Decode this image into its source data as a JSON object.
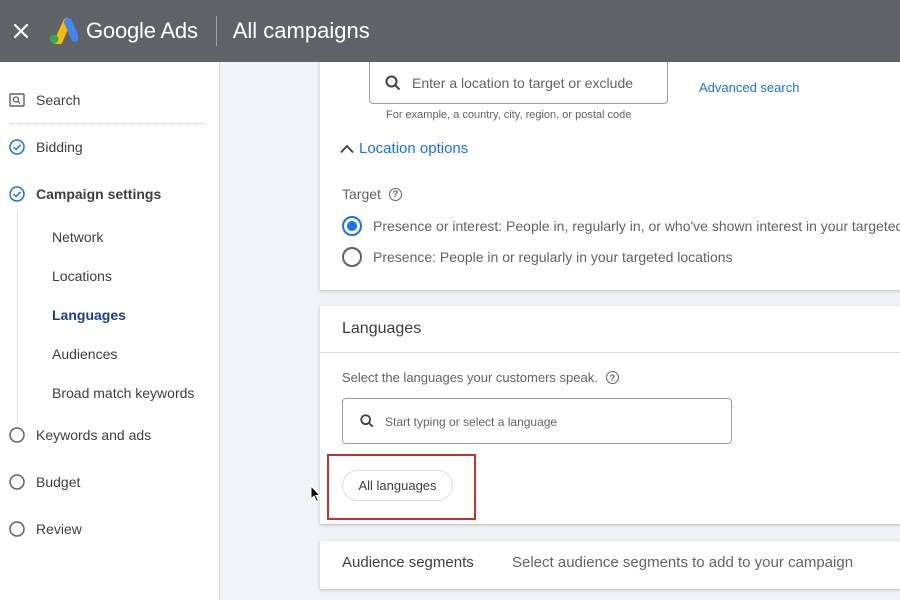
{
  "header": {
    "close_icon": "close-icon",
    "brand": "Google Ads",
    "title": "All campaigns"
  },
  "sidebar": {
    "items": [
      {
        "label": "Search",
        "icon": "search-icon",
        "state": "info"
      },
      {
        "label": "Bidding",
        "icon": "check-circle-icon",
        "state": "complete"
      },
      {
        "label": "Campaign settings",
        "icon": "check-circle-icon",
        "state": "complete"
      },
      {
        "label": "Keywords and ads",
        "icon": "circle-icon",
        "state": "incomplete"
      },
      {
        "label": "Budget",
        "icon": "circle-icon",
        "state": "incomplete"
      },
      {
        "label": "Review",
        "icon": "circle-icon",
        "state": "incomplete"
      }
    ],
    "sub_items": [
      "Network",
      "Locations",
      "Languages",
      "Audiences",
      "Broad match keywords"
    ],
    "active_sub_item": "Languages"
  },
  "locations": {
    "search_placeholder": "Enter a location to target or exclude",
    "helper_text": "For example, a country, city, region, or postal code",
    "advanced_search": "Advanced search",
    "options_label": "Location options",
    "target_label": "Target",
    "options": [
      {
        "label": "Presence or interest: People in, regularly in, or who've shown interest in your targeted",
        "selected": true
      },
      {
        "label": "Presence: People in or regularly in your targeted locations",
        "selected": false
      }
    ]
  },
  "languages": {
    "title": "Languages",
    "description": "Select the languages your customers speak.",
    "search_placeholder": "Start typing or select a language",
    "chip": "All languages"
  },
  "audience": {
    "title": "Audience segments",
    "description": "Select audience segments to add to your campaign"
  },
  "colors": {
    "topbar": "#5f6368",
    "accent": "#1a73e8",
    "active_nav": "#1a3f8f",
    "highlight": "#c9302c"
  }
}
